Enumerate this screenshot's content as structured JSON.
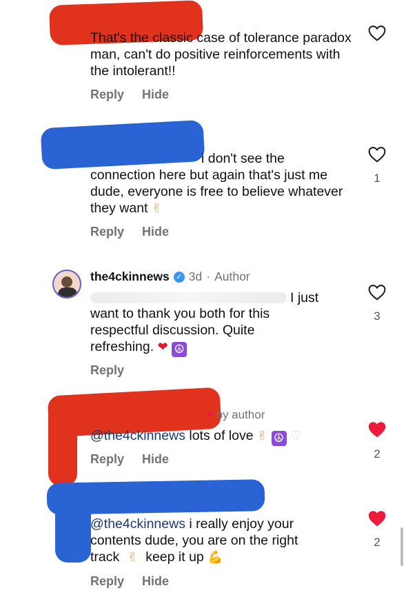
{
  "colors": {
    "accent_red": "#e0321c",
    "accent_blue": "#2a63d4",
    "like_active": "#ed1c3a",
    "meta_gray": "#737373",
    "verified_blue": "#3797f0"
  },
  "comments": [
    {
      "text": "That's the classic case of tolerance paradox man, can't do positive reinforcements with the intolerant!!",
      "reply_label": "Reply",
      "hide_label": "Hide",
      "like_icon": "heart-outline-icon"
    },
    {
      "text_prefix": "i don't see the",
      "text": "connection here but again that's just me dude, everyone is free to believe whatever they want",
      "emoji": "✌",
      "like_count": "1",
      "reply_label": "Reply",
      "hide_label": "Hide",
      "like_icon": "heart-outline-icon"
    },
    {
      "username": "the4ckinnews",
      "time": "3d",
      "role": "Author",
      "text_suffix": "I just",
      "text": "want to thank you both for this respectful discussion. Quite refreshing.",
      "emoji_heart": "❤",
      "emoji_peace": "☮",
      "like_count": "3",
      "reply_label": "Reply",
      "like_icon": "heart-outline-icon"
    },
    {
      "by_author": "by author",
      "mention": "@the4ckinnews",
      "text": "lots of love",
      "emoji_1": "✌",
      "emoji_2": "☮",
      "emoji_3": "♡",
      "like_count": "2",
      "reply_label": "Reply",
      "hide_label": "Hide",
      "like_icon": "heart-filled-icon"
    },
    {
      "mention": "@the4ckinnews",
      "text_1": "i really enjoy your",
      "text_2": "contents dude, you are on the right",
      "text_3a": "track",
      "emoji_1": "✌",
      "text_3b": "keep it up",
      "emoji_2": "💪",
      "like_count": "2",
      "reply_label": "Reply",
      "hide_label": "Hide",
      "like_icon": "heart-filled-icon"
    }
  ]
}
